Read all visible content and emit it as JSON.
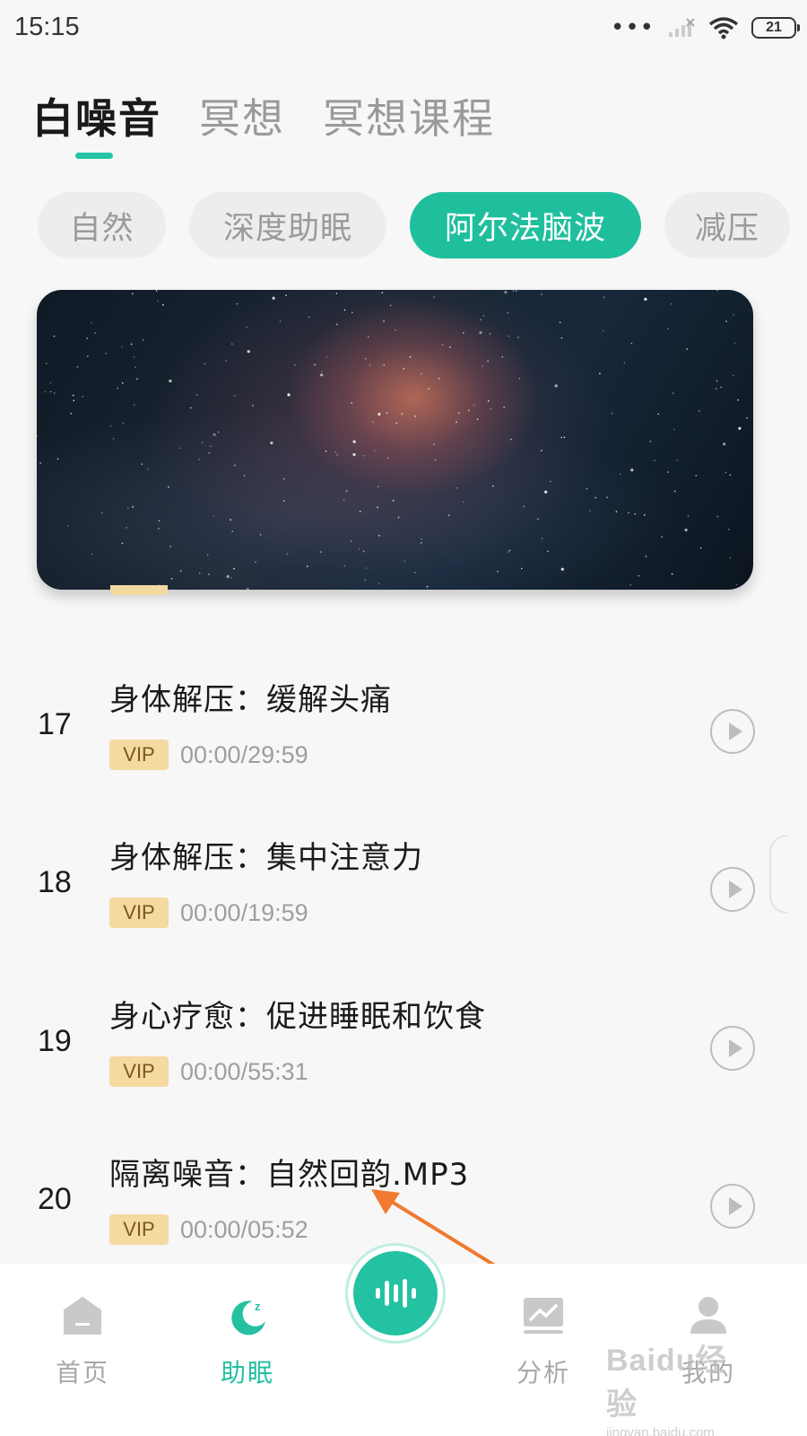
{
  "status_bar": {
    "time": "15:15",
    "battery": "21"
  },
  "top_tabs": [
    {
      "label": "白噪音",
      "active": true
    },
    {
      "label": "冥想",
      "active": false
    },
    {
      "label": "冥想课程",
      "active": false
    }
  ],
  "chips": [
    {
      "label": "自然",
      "active": false
    },
    {
      "label": "深度助眠",
      "active": false
    },
    {
      "label": "阿尔法脑波",
      "active": true
    },
    {
      "label": "减压",
      "active": false
    }
  ],
  "tracks": [
    {
      "number": "17",
      "title": "身体解压：缓解头痛",
      "badge": "VIP",
      "duration": "00:00/29:59"
    },
    {
      "number": "18",
      "title": "身体解压：集中注意力",
      "badge": "VIP",
      "duration": "00:00/19:59"
    },
    {
      "number": "19",
      "title": "身心疗愈：促进睡眠和饮食",
      "badge": "VIP",
      "duration": "00:00/55:31"
    },
    {
      "number": "20",
      "title": "隔离噪音：自然回韵.MP3",
      "badge": "VIP",
      "duration": "00:00/05:52"
    }
  ],
  "bottom_nav": [
    {
      "label": "首页",
      "icon": "home-icon",
      "active": false
    },
    {
      "label": "助眠",
      "icon": "moon-sleep-icon",
      "active": true
    },
    {
      "label": "分析",
      "icon": "analysis-chart-icon",
      "active": false
    },
    {
      "label": "我的",
      "icon": "profile-icon",
      "active": false
    }
  ],
  "center_button": {
    "icon": "sound-wave-icon"
  },
  "watermark": {
    "main": "Baidu经验",
    "sub": "jingyan.baidu.com"
  },
  "colors": {
    "accent": "#1fbf9d",
    "vip_badge": "#f4d9a1",
    "annotation_arrow": "#ef7a30"
  }
}
